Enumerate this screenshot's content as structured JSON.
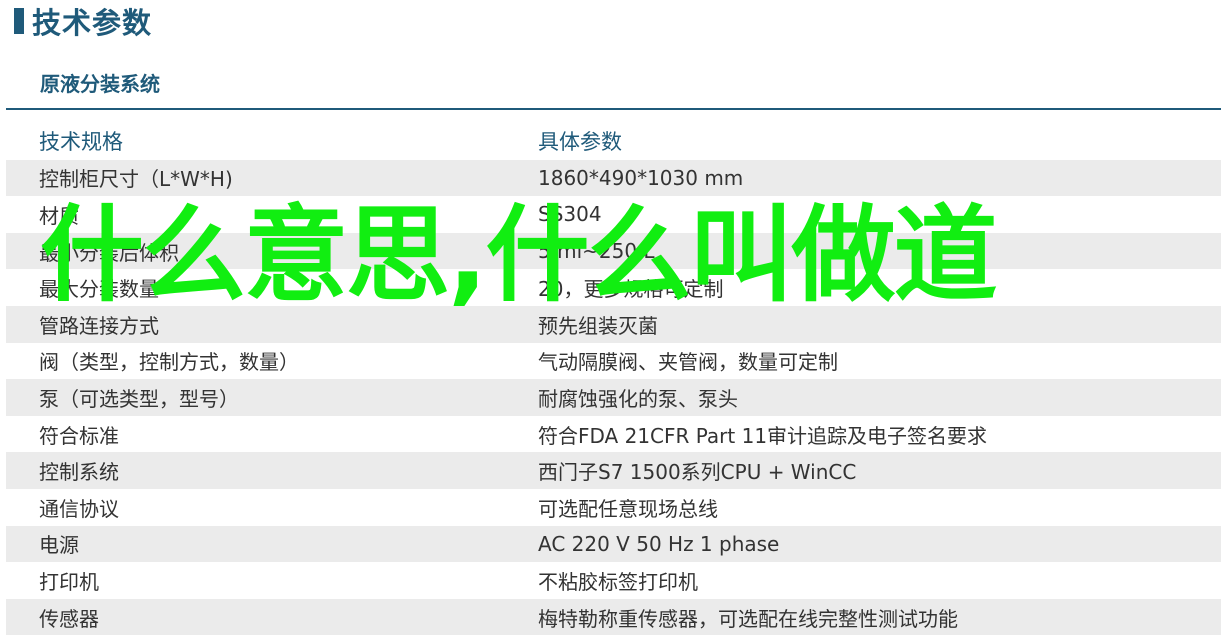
{
  "header": {
    "title": "技术参数"
  },
  "section": {
    "title": "原液分装系统"
  },
  "table": {
    "header": {
      "name": "技术规格",
      "value": "具体参数"
    },
    "rows": [
      {
        "name": "控制柜尺寸（L*W*H)",
        "value": "1860*490*1030 mm"
      },
      {
        "name": "材质",
        "value": "SS304"
      },
      {
        "name": "最小分装后体积",
        "value": "5 ml~250 L"
      },
      {
        "name": "最大分装数量",
        "value": "20，更多规格可定制"
      },
      {
        "name": "管路连接方式",
        "value": "预先组装灭菌"
      },
      {
        "name": "阀（类型，控制方式，数量）",
        "value": "气动隔膜阀、夹管阀，数量可定制"
      },
      {
        "name": "泵（可选类型，型号）",
        "value": "耐腐蚀强化的泵、泵头"
      },
      {
        "name": "符合标准",
        "value": "符合FDA 21CFR Part 11审计追踪及电子签名要求"
      },
      {
        "name": "控制系统",
        "value": "西门子S7 1500系列CPU + WinCC"
      },
      {
        "name": "通信协议",
        "value": "可选配任意现场总线"
      },
      {
        "name": "电源",
        "value": "AC 220 V 50 Hz 1 phase"
      },
      {
        "name": "打印机",
        "value": "不粘胶标签打印机"
      },
      {
        "name": "传感器",
        "value": "梅特勒称重传感器，可选配在线完整性测试功能"
      }
    ]
  },
  "watermark": {
    "text": "什么意思,什么叫做道"
  },
  "colors": {
    "brand": "#1f5a7a",
    "row_alt": "#ebebeb",
    "watermark": "#11ee11"
  }
}
